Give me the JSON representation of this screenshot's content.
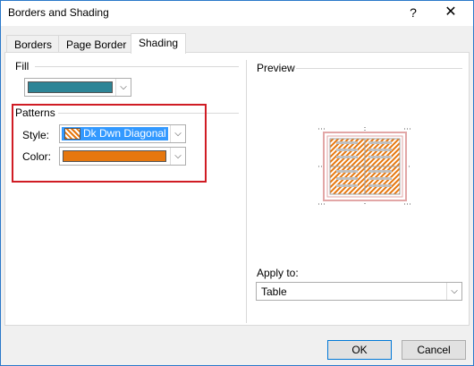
{
  "window": {
    "title": "Borders and Shading",
    "help_glyph": "?",
    "close_glyph": "✕"
  },
  "tabs": [
    {
      "label": "Borders",
      "active": false
    },
    {
      "label": "Page Border",
      "active": false
    },
    {
      "label": "Shading",
      "active": true
    }
  ],
  "fill": {
    "label": "Fill",
    "color": "#2d8597"
  },
  "patterns": {
    "label": "Patterns",
    "style_label": "Style:",
    "style_value": "Dk Dwn Diagonal",
    "color_label": "Color:",
    "color_value": "#e6770e"
  },
  "preview": {
    "label": "Preview",
    "border_color": "#e2a6a6",
    "stripe_color": "#e6770e"
  },
  "apply_to": {
    "label": "Apply to:",
    "value": "Table"
  },
  "buttons": {
    "ok": "OK",
    "cancel": "Cancel"
  }
}
